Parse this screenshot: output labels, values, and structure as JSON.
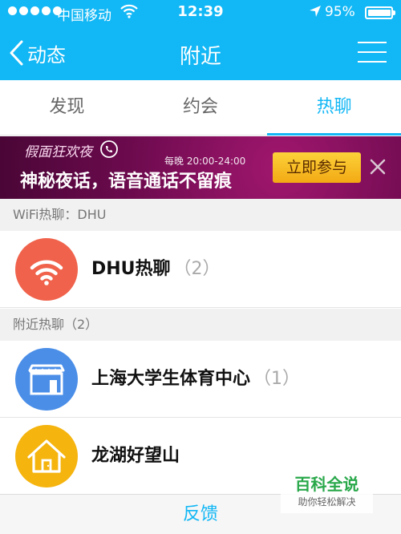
{
  "status_bar": {
    "carrier": "中国移动",
    "time": "12:39",
    "battery": "95%"
  },
  "nav": {
    "back_label": "动态",
    "title": "附近"
  },
  "tabs": [
    {
      "label": "发现",
      "active": false
    },
    {
      "label": "约会",
      "active": false
    },
    {
      "label": "热聊",
      "active": true
    }
  ],
  "banner": {
    "logo_text": "假面狂欢夜",
    "schedule": "每晚 20:00-24:00",
    "slogan": "神秘夜话，语音通话不留痕",
    "button_label": "立即参与"
  },
  "wifi_section": {
    "header": "WiFi热聊：DHU",
    "items": [
      {
        "name": "DHU热聊",
        "count": "（2）",
        "icon": "wifi-icon",
        "color": "#f0624b"
      }
    ]
  },
  "nearby_section": {
    "header": "附近热聊（2）",
    "items": [
      {
        "name": "上海大学生体育中心",
        "count": "（1）",
        "icon": "shop-icon",
        "color": "#4a8ee8"
      },
      {
        "name": "龙湖好望山",
        "count": "",
        "icon": "house-icon",
        "color": "#f5b40e"
      }
    ]
  },
  "footer": {
    "feedback_label": "反馈"
  },
  "watermark": {
    "main": "百科全说",
    "sub": "助你轻松解决"
  },
  "colors": {
    "accent": "#12b7f5"
  }
}
